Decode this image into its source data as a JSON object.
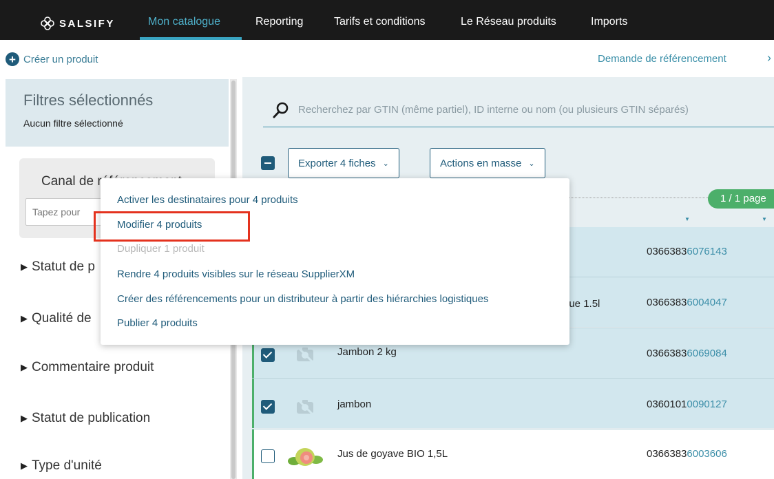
{
  "nav": {
    "logo_text": "SALSIFY",
    "tabs": [
      {
        "label": "Mon catalogue",
        "active": true
      },
      {
        "label": "Reporting",
        "active": false
      },
      {
        "label": "Tarifs et conditions",
        "active": false
      },
      {
        "label": "Le Réseau produits",
        "active": false
      },
      {
        "label": "Imports",
        "active": false
      }
    ]
  },
  "subbar": {
    "create_label": "Créer un produit",
    "create_icon": "plus-circle-icon",
    "ref_link": "Demande de référencement",
    "chevron": "›"
  },
  "sidebar": {
    "filters_title": "Filtres sélectionnés",
    "filters_subtitle": "Aucun filtre sélectionné",
    "canal_title": "Canal de référencement",
    "canal_placeholder": "Tapez pour",
    "facets": [
      {
        "label": "Statut de p"
      },
      {
        "label": "Qualité de"
      },
      {
        "label": "Commentaire produit"
      },
      {
        "label": "Statut de publication"
      },
      {
        "label": "Type d'unité"
      }
    ]
  },
  "main": {
    "search_placeholder": "Recherchez par GTIN (même partiel), ID interne ou nom (ou plusieurs GTIN séparés)",
    "export_label": "Exporter 4 fiches",
    "mass_actions_label": "Actions en masse",
    "pager_label": "1 / 1 page",
    "rows": [
      {
        "name": "",
        "gtin_prefix": "0366383",
        "gtin_suffix": "6076143",
        "checked": true
      },
      {
        "name": "que 1.5l",
        "gtin_prefix": "0366383",
        "gtin_suffix": "6004047",
        "checked": true
      },
      {
        "name": "Jambon 2 kg",
        "gtin_prefix": "0366383",
        "gtin_suffix": "6069084",
        "checked": true
      },
      {
        "name": "jambon",
        "gtin_prefix": "0360101",
        "gtin_suffix": "0090127",
        "checked": true
      },
      {
        "name": "Jus de goyave BIO 1,5L",
        "gtin_prefix": "0366383",
        "gtin_suffix": "6003606",
        "checked": false
      }
    ]
  },
  "menu": {
    "items": [
      {
        "label": "Activer les destinataires pour 4 produits",
        "disabled": false
      },
      {
        "label": "Modifier 4 produits",
        "disabled": false,
        "highlighted": true
      },
      {
        "label": "Dupliquer 1 produit",
        "disabled": true
      },
      {
        "label": "Rendre 4 produits visibles sur le réseau SupplierXM",
        "disabled": false
      },
      {
        "label": "Créer des référencements pour un distributeur à partir des hiérarchies logistiques",
        "disabled": false
      },
      {
        "label": "Publier 4 produits",
        "disabled": false
      }
    ]
  },
  "colors": {
    "nav_bg": "#1a1a1a",
    "nav_active": "#4fb2cc",
    "primary": "#1f5b7a",
    "link": "#3b8ea8",
    "selected_row": "#d2e7ee",
    "pager_green": "#4caf6a",
    "highlight_red": "#e4321e"
  }
}
